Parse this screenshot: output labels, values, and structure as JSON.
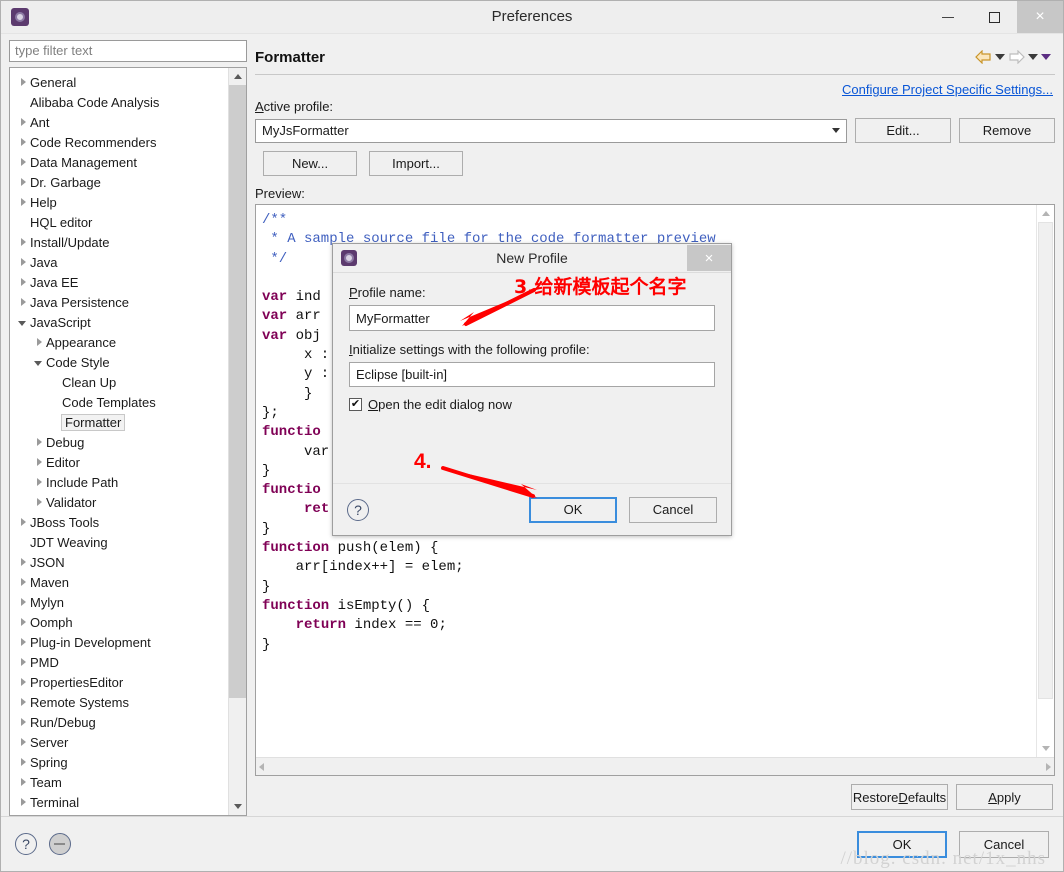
{
  "window": {
    "title": "Preferences",
    "icon": "eclipse-icon",
    "minimize": "–",
    "maximize": "□",
    "close": "×"
  },
  "sidebar": {
    "filter_placeholder": "type filter text",
    "filter_value": "",
    "items": [
      {
        "label": "General",
        "indent": 0,
        "state": "closed"
      },
      {
        "label": "Alibaba Code Analysis",
        "indent": 0,
        "state": "leaf"
      },
      {
        "label": "Ant",
        "indent": 0,
        "state": "closed"
      },
      {
        "label": "Code Recommenders",
        "indent": 0,
        "state": "closed"
      },
      {
        "label": "Data Management",
        "indent": 0,
        "state": "closed"
      },
      {
        "label": "Dr. Garbage",
        "indent": 0,
        "state": "closed"
      },
      {
        "label": "Help",
        "indent": 0,
        "state": "closed"
      },
      {
        "label": "HQL editor",
        "indent": 0,
        "state": "leaf"
      },
      {
        "label": "Install/Update",
        "indent": 0,
        "state": "closed"
      },
      {
        "label": "Java",
        "indent": 0,
        "state": "closed"
      },
      {
        "label": "Java EE",
        "indent": 0,
        "state": "closed"
      },
      {
        "label": "Java Persistence",
        "indent": 0,
        "state": "closed"
      },
      {
        "label": "JavaScript",
        "indent": 0,
        "state": "open"
      },
      {
        "label": "Appearance",
        "indent": 1,
        "state": "closed"
      },
      {
        "label": "Code Style",
        "indent": 1,
        "state": "open"
      },
      {
        "label": "Clean Up",
        "indent": 2,
        "state": "leaf"
      },
      {
        "label": "Code Templates",
        "indent": 2,
        "state": "leaf"
      },
      {
        "label": "Formatter",
        "indent": 2,
        "state": "leaf",
        "selected": true
      },
      {
        "label": "Debug",
        "indent": 1,
        "state": "closed"
      },
      {
        "label": "Editor",
        "indent": 1,
        "state": "closed"
      },
      {
        "label": "Include Path",
        "indent": 1,
        "state": "closed"
      },
      {
        "label": "Validator",
        "indent": 1,
        "state": "closed"
      },
      {
        "label": "JBoss Tools",
        "indent": 0,
        "state": "closed"
      },
      {
        "label": "JDT Weaving",
        "indent": 0,
        "state": "leaf"
      },
      {
        "label": "JSON",
        "indent": 0,
        "state": "closed"
      },
      {
        "label": "Maven",
        "indent": 0,
        "state": "closed"
      },
      {
        "label": "Mylyn",
        "indent": 0,
        "state": "closed"
      },
      {
        "label": "Oomph",
        "indent": 0,
        "state": "closed"
      },
      {
        "label": "Plug-in Development",
        "indent": 0,
        "state": "closed"
      },
      {
        "label": "PMD",
        "indent": 0,
        "state": "closed"
      },
      {
        "label": "PropertiesEditor",
        "indent": 0,
        "state": "closed"
      },
      {
        "label": "Remote Systems",
        "indent": 0,
        "state": "closed"
      },
      {
        "label": "Run/Debug",
        "indent": 0,
        "state": "closed"
      },
      {
        "label": "Server",
        "indent": 0,
        "state": "closed"
      },
      {
        "label": "Spring",
        "indent": 0,
        "state": "closed"
      },
      {
        "label": "Team",
        "indent": 0,
        "state": "closed"
      },
      {
        "label": "Terminal",
        "indent": 0,
        "state": "closed"
      }
    ]
  },
  "page": {
    "title": "Formatter",
    "configure_link": "Configure Project Specific Settings...",
    "active_profile_label": "Active profile:",
    "active_profile_value": "MyJsFormatter",
    "edit_button": "Edit...",
    "remove_button": "Remove",
    "new_button": "New...",
    "import_button": "Import...",
    "preview_label": "Preview:",
    "restore_defaults_button": "Restore Defaults",
    "apply_button": "Apply"
  },
  "preview_code": {
    "lines": [
      {
        "text": "/**",
        "cls": "cmt-b"
      },
      {
        "text": " * A sample source file for the code formatter preview",
        "cls": "cmt-b"
      },
      {
        "text": " */",
        "cls": "cmt-b"
      },
      {
        "text": "",
        "cls": ""
      },
      {
        "text": "var ind",
        "cls": "kw-var"
      },
      {
        "text": "var arr",
        "cls": "kw-var"
      },
      {
        "text": "var obj",
        "cls": "kw-var"
      },
      {
        "text": "     x :",
        "cls": ""
      },
      {
        "text": "     y :",
        "cls": ""
      },
      {
        "text": "     }",
        "cls": ""
      },
      {
        "text": "};",
        "cls": ""
      },
      {
        "text": "functio",
        "cls": "kw"
      },
      {
        "text": "     var",
        "cls": ""
      },
      {
        "text": "}",
        "cls": ""
      },
      {
        "text": "functio",
        "cls": "kw"
      },
      {
        "text": "     ret",
        "cls": "kw-ret"
      },
      {
        "text": "}",
        "cls": ""
      }
    ],
    "tail_lines": [
      "function push(elem) {",
      "    arr[index++] = elem;",
      "}",
      "function isEmpty() {",
      "    return index == 0;",
      "}"
    ]
  },
  "footer": {
    "help_icon": "?",
    "ok_button": "OK",
    "cancel_button": "Cancel"
  },
  "modal": {
    "title": "New Profile",
    "icon": "eclipse-icon",
    "close": "×",
    "profile_name_label": "Profile name:",
    "profile_name_value": "MyFormatter",
    "init_label": "Initialize settings with the following profile:",
    "init_value": "Eclipse [built-in]",
    "open_edit_label": "Open the edit dialog now",
    "open_edit_checked": true,
    "help_icon": "?",
    "ok_button": "OK",
    "cancel_button": "Cancel"
  },
  "annotations": [
    {
      "id": "step3",
      "text": "3.给新模板起个名字",
      "color": "#ff0000"
    },
    {
      "id": "step4",
      "text": "4.",
      "color": "#ff0000"
    }
  ],
  "watermark": "//blog. csdn. net/1x_nhs",
  "colors": {
    "link": "#0a56d6",
    "annotation": "#ff0000",
    "accent_border": "#3a8ddd",
    "keyword": "#7f0055",
    "comment": "#3f5fbf"
  }
}
